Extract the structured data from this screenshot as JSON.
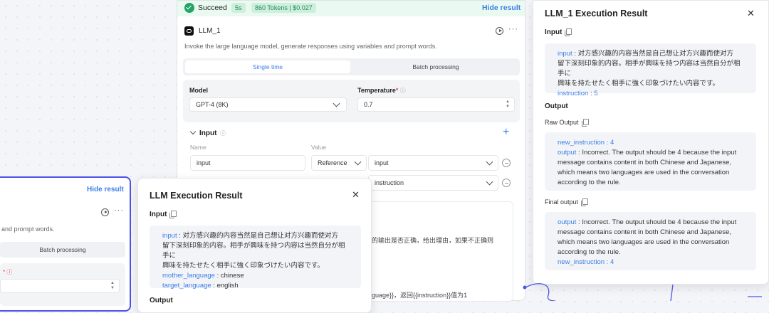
{
  "status_bar": {
    "status": "Succeed",
    "time": "5s",
    "tokens": "860 Tokens | $0.027",
    "hide": "Hide result"
  },
  "node": {
    "name": "LLM_1",
    "description": "Invoke the large language model, generate responses using variables and prompt words.",
    "tabs": [
      "Single time",
      "Batch processing"
    ],
    "model_label": "Model",
    "model_value": "GPT-4 (8K)",
    "temperature_label": "Temperature",
    "temperature_required": "*",
    "temperature_value": "0.7",
    "input_label": "Input",
    "col_name": "Name",
    "col_value": "Value",
    "rows": [
      {
        "name": "input",
        "type": "Reference",
        "value": "input"
      },
      {
        "name": "",
        "type": "",
        "value": "instruction"
      }
    ],
    "bg_text1": "的输出是否正确，给出理由，如果不正确则",
    "bg_text2": "guage}}，返回{{instruction}}值为1"
  },
  "left_node": {
    "hide": "Hide result",
    "desc": "and prompt words.",
    "tab": "Batch processing",
    "temp_fragment": "* ⓘ"
  },
  "llm_result": {
    "title": "LLM Execution Result",
    "input_label": "Input",
    "input_key": "input",
    "input_text": "对方感兴趣的内容当然是自己想让对方兴趣而使对方留下深刻印象的内容。相手が興味を持つ内容は当然自分が相手に興味を持たせたく相手に強く印象づけたい内容です。",
    "input_line1": "对方感兴趣的内容当然是自己想让对方兴趣而使对方",
    "input_line2": "留下深刻印象的内容。相手が興味を持つ内容は当然自分が相手に",
    "input_line3": "興味を持たせたく相手に強く印象づけたい内容です。",
    "mother_key": "mother_language",
    "mother_value": "chinese",
    "target_key": "target_language",
    "target_value": "english",
    "output_label": "Output"
  },
  "llm1_result": {
    "title": "LLM_1 Execution Result",
    "input_label": "Input",
    "input_key": "input",
    "input_line1": "对方感兴趣的内容当然是自己想让对方兴趣而使对方",
    "input_line2": "留下深刻印象的内容。相手が興味を持つ内容は当然自分が相手に",
    "input_line3": "興味を持たせたく相手に強く印象づけたい内容です。",
    "instruction_key": "instruction",
    "instruction_value": "5",
    "output_label": "Output",
    "raw_output_label": "Raw Output",
    "raw_new_instruction_key": "new_instruction",
    "raw_new_instruction_value": "4",
    "raw_output_key": "output",
    "raw_output_text": "Incorrect. The output should be 4 because the input message contains content in both Chinese and Japanese, which means two languages are used in the conversation according to the rule.",
    "final_output_label": "Final output",
    "final_output_key": "output",
    "final_output_text": "Incorrect. The output should be 4 because the input message contains content in both Chinese and Japanese, which means two languages are used in the conversation according to the rule.",
    "final_new_instruction_key": "new_instruction",
    "final_new_instruction_value": "4"
  },
  "colors": {
    "success": "#22a565",
    "link": "#3d7ee8",
    "accent": "#4d53e8"
  }
}
